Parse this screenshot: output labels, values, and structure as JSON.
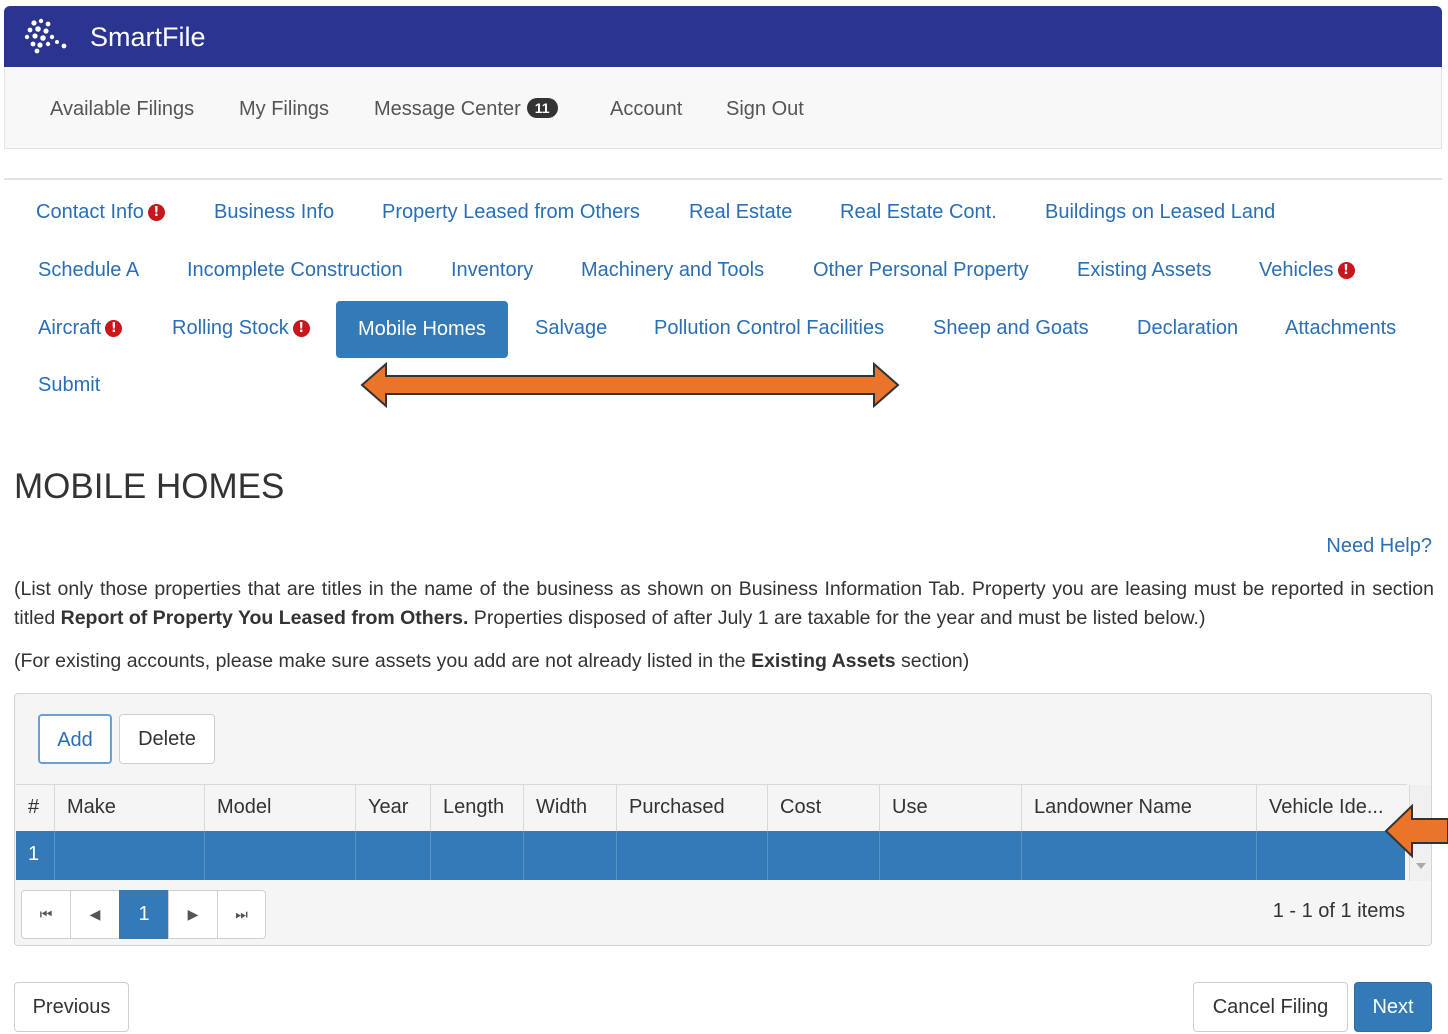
{
  "app": {
    "brand": "SmartFile"
  },
  "nav": {
    "items": [
      "Available Filings",
      "My Filings",
      "Message Center",
      "Account",
      "Sign Out"
    ],
    "message_count": "11"
  },
  "tabs": [
    {
      "label": "Contact Info",
      "warning": true
    },
    {
      "label": "Business Info",
      "warning": false
    },
    {
      "label": "Property Leased from Others",
      "warning": false
    },
    {
      "label": "Real Estate",
      "warning": false
    },
    {
      "label": "Real Estate Cont.",
      "warning": false
    },
    {
      "label": "Buildings on Leased Land",
      "warning": false
    },
    {
      "label": "Schedule A",
      "warning": false
    },
    {
      "label": "Incomplete Construction",
      "warning": false
    },
    {
      "label": "Inventory",
      "warning": false
    },
    {
      "label": "Machinery and Tools",
      "warning": false
    },
    {
      "label": "Other Personal Property",
      "warning": false
    },
    {
      "label": "Existing Assets",
      "warning": false
    },
    {
      "label": "Vehicles",
      "warning": true
    },
    {
      "label": "Aircraft",
      "warning": true
    },
    {
      "label": "Rolling Stock",
      "warning": true
    },
    {
      "label": "Mobile Homes",
      "warning": false,
      "active": true
    },
    {
      "label": "Salvage",
      "warning": false
    },
    {
      "label": "Pollution Control Facilities",
      "warning": false
    },
    {
      "label": "Sheep and Goats",
      "warning": false
    },
    {
      "label": "Declaration",
      "warning": false
    },
    {
      "label": "Attachments",
      "warning": false
    },
    {
      "label": "Submit",
      "warning": false
    }
  ],
  "page": {
    "title": "MOBILE HOMES",
    "help": "Need Help?",
    "para1_a": "(List only those properties that are titles in the name of the business as shown on Business Information Tab. Property you are leasing must be reported in section titled ",
    "para1_b": "Report of Property You Leased from Others.",
    "para1_c": " Properties disposed of after July 1 are taxable for the year and must be listed below.)",
    "para2_a": "(For existing accounts, please make sure assets you add are not already listed in the ",
    "para2_b": "Existing Assets",
    "para2_c": " section)"
  },
  "grid": {
    "toolbar": {
      "add": "Add",
      "delete": "Delete"
    },
    "columns": [
      "#",
      "Make",
      "Model",
      "Year",
      "Length",
      "Width",
      "Purchased",
      "Cost",
      "Use",
      "Landowner Name",
      "Vehicle Ide..."
    ],
    "rows": [
      {
        "num": "1"
      }
    ],
    "pager": {
      "first": "⏮",
      "prev": "◀",
      "page": "1",
      "next": "▶",
      "last": "⏭",
      "info": "1 - 1 of 1 items"
    }
  },
  "footer": {
    "previous": "Previous",
    "cancel": "Cancel Filing",
    "next": "Next"
  },
  "colors": {
    "header": "#2b3590",
    "accent": "#337ab7",
    "link": "#2a6eb5",
    "warning": "#c9161d",
    "annotation_arrow": "#e9742a"
  }
}
